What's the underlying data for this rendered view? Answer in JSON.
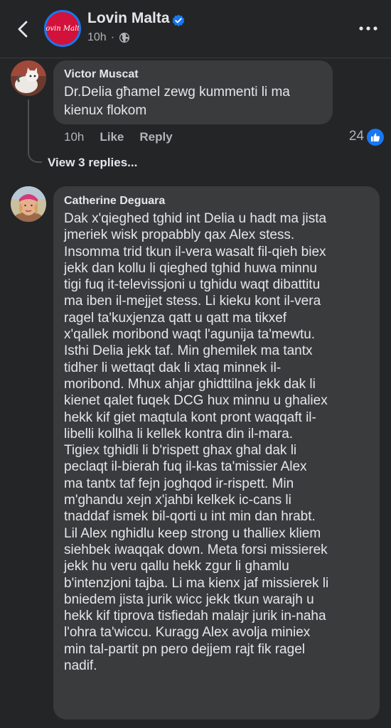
{
  "header": {
    "page_name": "Lovin Malta",
    "logo_text": "Lovin Malta",
    "time": "10h",
    "separator": "·"
  },
  "comments": [
    {
      "author": "Victor Muscat",
      "text": "Dr.Delia għamel zewg kummenti li ma kienux flokom",
      "time": "10h",
      "like_label": "Like",
      "reply_label": "Reply",
      "reactions": "24",
      "view_replies": "View 3 replies..."
    },
    {
      "author": "Catherine Deguara",
      "lines": [
        "Dak x'qieghed tghid int Delia u hadt ma jista",
        "jmeriek wisk propabbly qax Alex stess.",
        "Insomma trid tkun il-vera wasalt fil-qieh biex",
        "jekk dan kollu li qieghed tghid huwa minnu",
        "tigi fuq it-televissjoni u tghidu waqt dibattitu",
        "ma iben il-mejjet stess. Li kieku kont il-vera",
        "ragel ta'kuxjenza qatt u qatt ma tikxef",
        "x'qallek moribond waqt l'agunija ta'mewtu.",
        "Isthi Delia jekk taf. Min ghemilek ma tantx",
        "tidher li wettaqt dak li xtaq minnek il-",
        "moribond. Mhux ahjar ghidttilna jekk dak li",
        "kienet qalet fuqek DCG hux minnu u ghaliex",
        "hekk kif giet maqtula kont pront waqqaft il-",
        "libelli kollha li kellek kontra din il-mara.",
        "Tigiex tghidli li b'rispett ghax ghal dak li",
        "peclaqt il-bierah fuq il-kas ta'missier Alex",
        "ma tantx taf fejn joghqod ir-rispett. Min",
        "m'ghandu xejn x'jahbi kelkek ic-cans li",
        "tnaddaf ismek bil-qorti u int min dan hrabt.",
        "Lil Alex nghidlu keep strong u thalliex kliem",
        "siehbek iwaqqak down. Meta forsi missierek",
        "jekk hu veru qallu hekk zgur li ghamlu",
        "b'intenzjoni tajba. Li ma kienx jaf missierek li",
        "bniedem jista jurik wicc jekk tkun warajh u",
        "hekk kif tiprova tisfiedah malajr jurik in-naha",
        "l'ohra ta'wiccu. Kuragg Alex avolja miniex",
        "min tal-partit pn pero dejjem rajt fik ragel",
        "nadif."
      ]
    }
  ],
  "colors": {
    "background": "#242526",
    "bubble": "#3a3b3c",
    "primary_text": "#e4e6eb",
    "secondary_text": "#b0b3b8",
    "accent_blue": "#1877f2",
    "logo_red": "#d2123b"
  },
  "icons": [
    "back-arrow-icon",
    "verified-badge-icon",
    "globe-icon",
    "more-options-icon",
    "like-thumb-icon"
  ]
}
